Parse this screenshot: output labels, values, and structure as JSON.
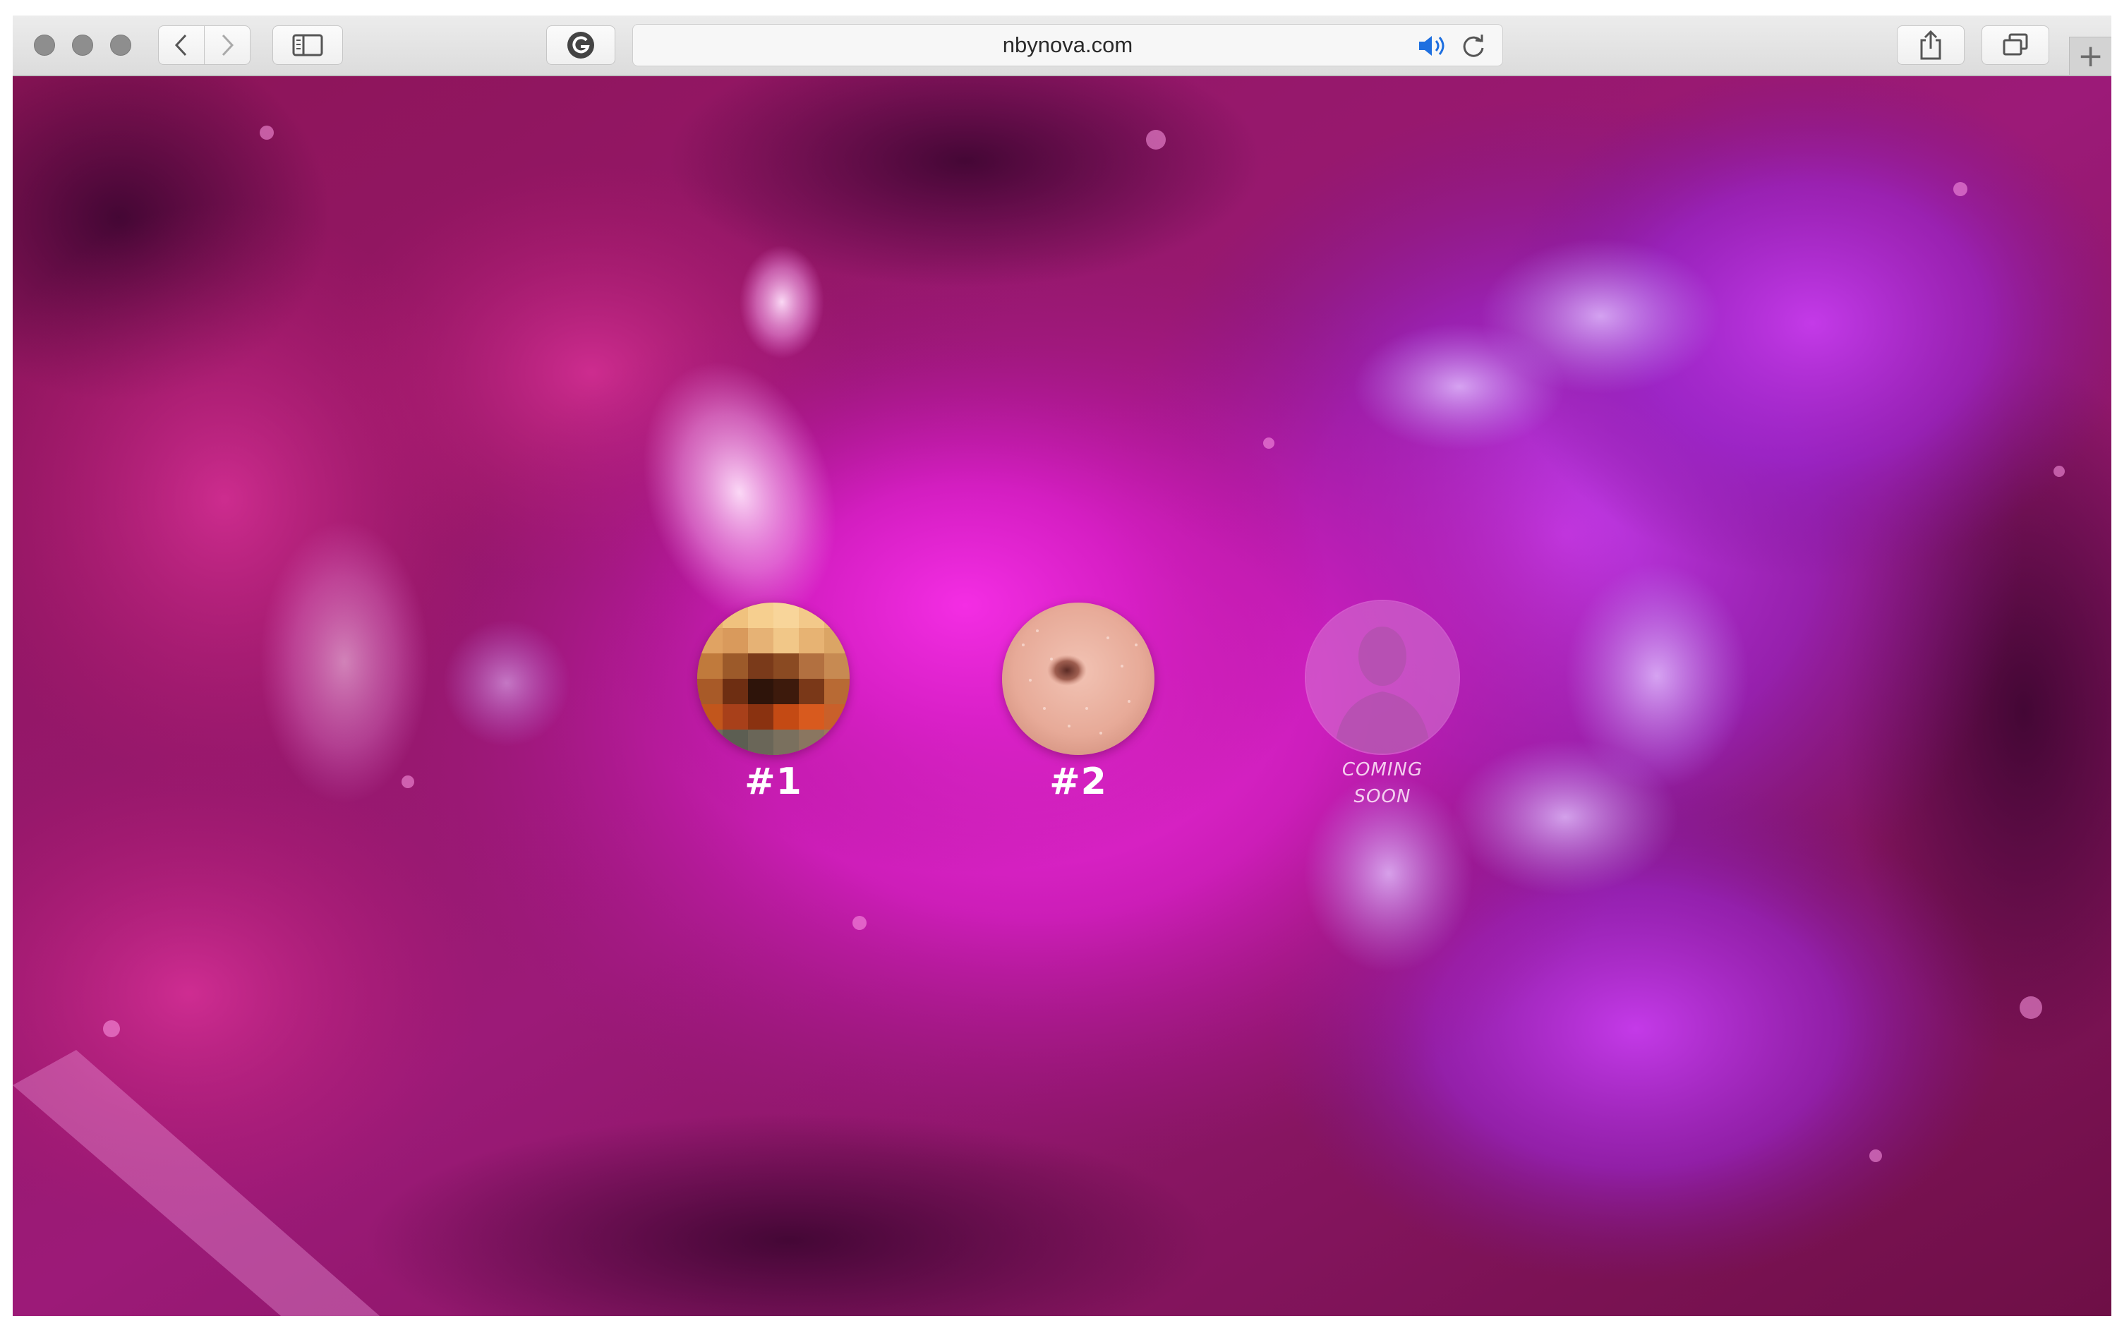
{
  "browser": {
    "url": "nbynova.com",
    "new_tab_symbol": "+",
    "icons": {
      "back": "chevron-left-icon",
      "forward": "chevron-right-icon",
      "sidebar": "sidebar-icon",
      "extension": "g-extension-icon",
      "audio": "speaker-icon",
      "reload": "reload-icon",
      "share": "share-icon",
      "tabs": "tabs-overview-icon"
    }
  },
  "page": {
    "background_colors": [
      "#7a0f4f",
      "#e81fd6",
      "#b023c8"
    ],
    "items": [
      {
        "label": "#1",
        "thumbnail": "pixelated-photo",
        "status": "available"
      },
      {
        "label": "#2",
        "thumbnail": "skin-closeup-photo",
        "status": "available"
      },
      {
        "label_line1": "COMING",
        "label_line2": "SOON",
        "thumbnail": "person-silhouette-icon",
        "status": "coming-soon"
      }
    ]
  }
}
